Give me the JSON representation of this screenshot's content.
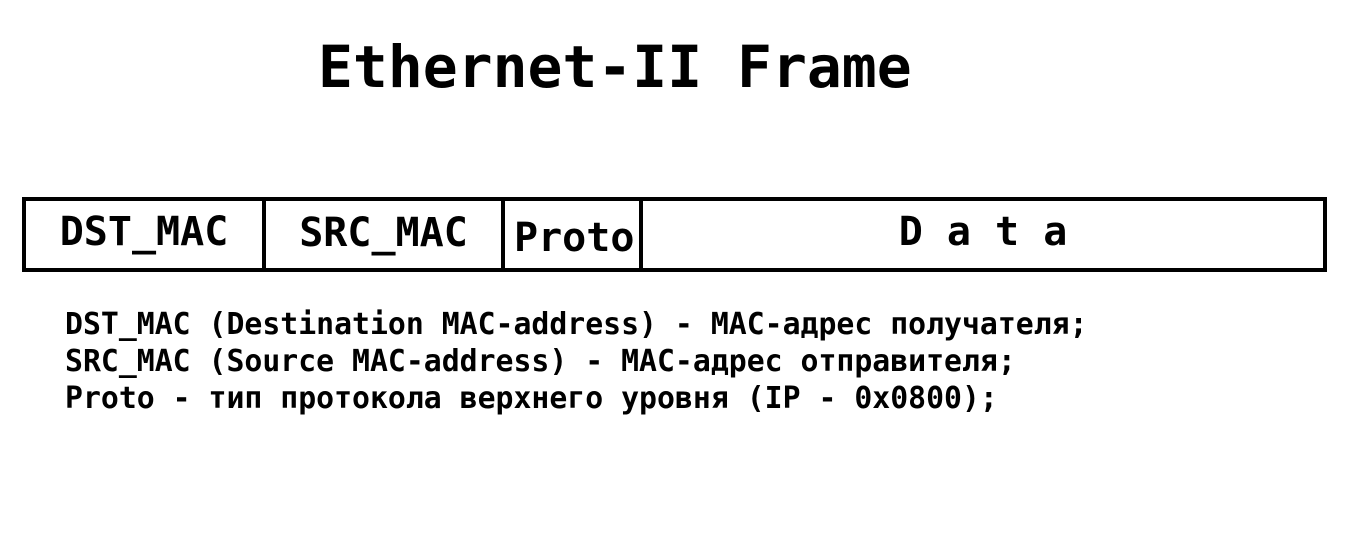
{
  "title": "Ethernet-II Frame",
  "frame_fields": [
    {
      "label": "DST_MAC"
    },
    {
      "label": "SRC_MAC"
    },
    {
      "label": "Proto"
    },
    {
      "label": "D a t a"
    }
  ],
  "descriptions": [
    "DST_MAC (Destination MAC-address) - MAC-адрес получателя;",
    "SRC_MAC (Source MAC-address) - MAC-адрес отправителя;",
    "Proto - тип протокола верхнего уровня (IP - 0x0800);"
  ]
}
